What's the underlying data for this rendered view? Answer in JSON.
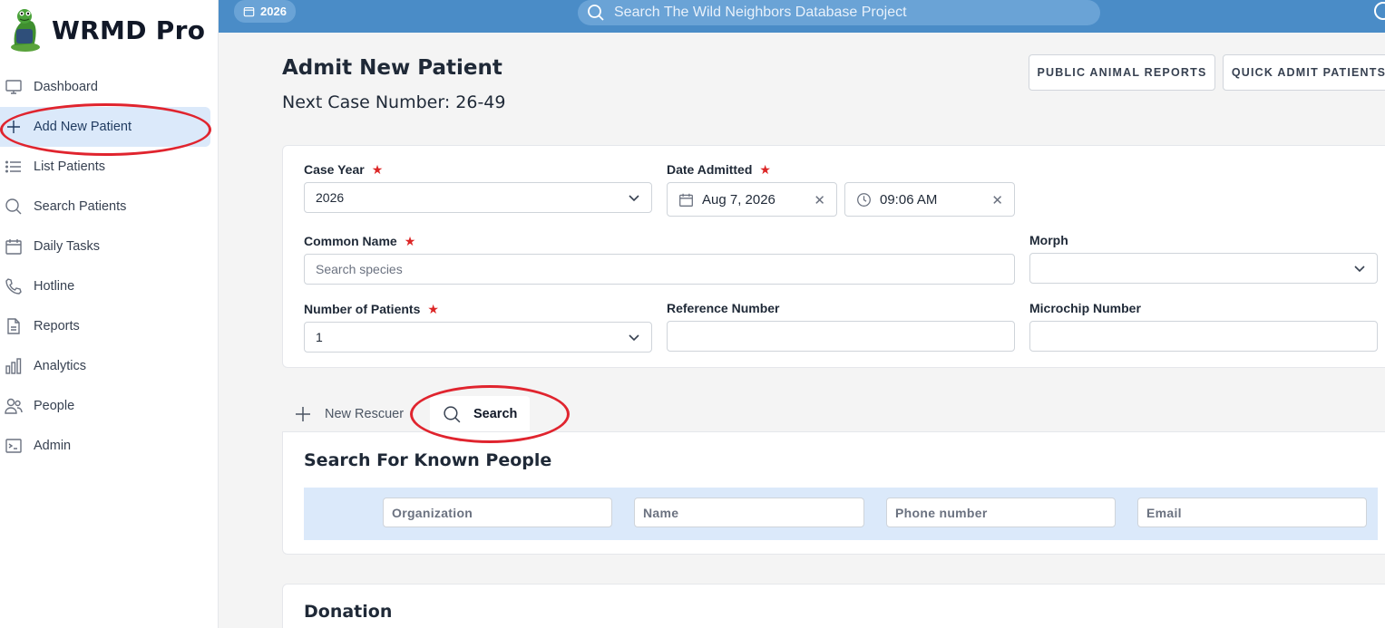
{
  "app": {
    "name": "WRMD Pro"
  },
  "sidebar": {
    "items": [
      {
        "label": "Dashboard",
        "icon": "monitor-icon"
      },
      {
        "label": "Add New Patient",
        "icon": "plus-icon",
        "active": true
      },
      {
        "label": "List Patients",
        "icon": "list-icon"
      },
      {
        "label": "Search Patients",
        "icon": "search-icon"
      },
      {
        "label": "Daily Tasks",
        "icon": "calendar-icon"
      },
      {
        "label": "Hotline",
        "icon": "phone-icon"
      },
      {
        "label": "Reports",
        "icon": "document-icon"
      },
      {
        "label": "Analytics",
        "icon": "bar-chart-icon"
      },
      {
        "label": "People",
        "icon": "people-icon"
      },
      {
        "label": "Admin",
        "icon": "terminal-icon"
      }
    ]
  },
  "topbar": {
    "year_label": "2026",
    "search_placeholder": "Search The Wild Neighbors Database Project",
    "accent_color": "#4a8cc7"
  },
  "header": {
    "title": "Admit New Patient",
    "next_case": "Next Case Number: 26-49",
    "buttons": [
      "PUBLIC ANIMAL REPORTS",
      "QUICK ADMIT PATIENTS"
    ]
  },
  "form": {
    "case_year": {
      "label": "Case Year",
      "value": "2026"
    },
    "date_admitted": {
      "label": "Date Admitted",
      "date": "Aug 7, 2026",
      "time": "09:06 AM"
    },
    "common_name": {
      "label": "Common Name",
      "placeholder": "Search species"
    },
    "morph": {
      "label": "Morph",
      "value": ""
    },
    "number_of_patients": {
      "label": "Number of Patients",
      "value": "1"
    },
    "reference_number": {
      "label": "Reference Number",
      "value": ""
    },
    "microchip_number": {
      "label": "Microchip Number",
      "value": ""
    }
  },
  "rescuer_tabs": {
    "new_label": "New Rescuer",
    "search_label": "Search"
  },
  "known_people": {
    "title": "Search For Known People",
    "fields": [
      "Organization",
      "Name",
      "Phone number",
      "Email"
    ]
  },
  "donation": {
    "title": "Donation"
  },
  "annotation_color": "#e0242e"
}
